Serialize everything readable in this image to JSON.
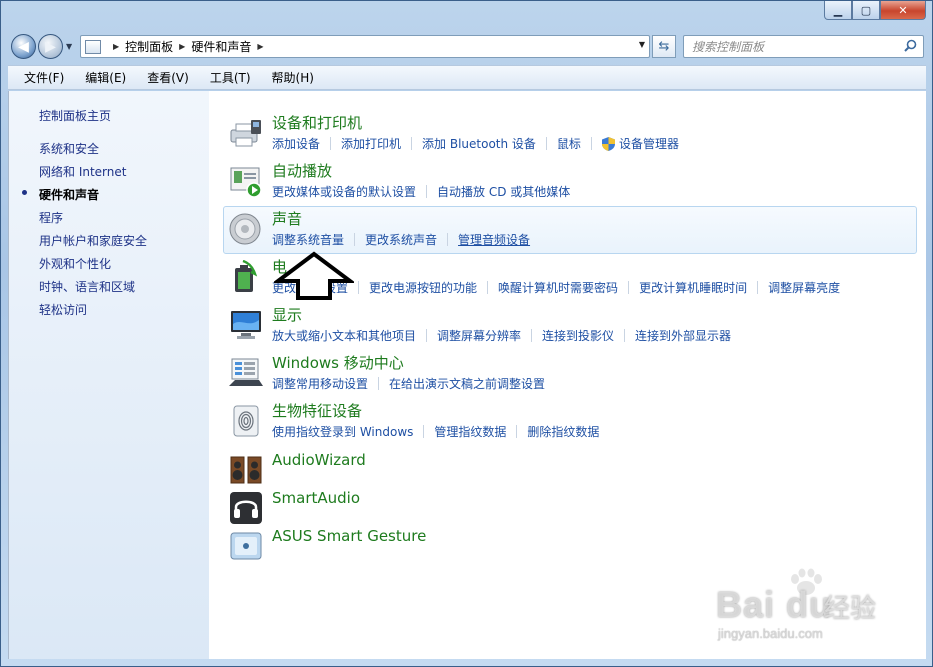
{
  "window": {
    "caption": {
      "minimize": "▁",
      "maximize": "▢",
      "close": "✕"
    }
  },
  "nav": {
    "breadcrumb": [
      "控制面板",
      "硬件和声音"
    ],
    "search_placeholder": "搜索控制面板"
  },
  "menu": [
    "文件(F)",
    "编辑(E)",
    "查看(V)",
    "工具(T)",
    "帮助(H)"
  ],
  "left_pane": {
    "home": "控制面板主页",
    "items": [
      "系统和安全",
      "网络和 Internet",
      "硬件和声音",
      "程序",
      "用户帐户和家庭安全",
      "外观和个性化",
      "时钟、语言和区域",
      "轻松访问"
    ],
    "current": "硬件和声音"
  },
  "categories": [
    {
      "title": "设备和打印机",
      "icon": "printer-icon",
      "links": [
        "添加设备",
        "添加打印机",
        "添加 Bluetooth 设备",
        "鼠标",
        "设备管理器"
      ]
    },
    {
      "title": "自动播放",
      "icon": "autoplay-icon",
      "links": [
        "更改媒体或设备的默认设置",
        "自动播放 CD 或其他媒体"
      ]
    },
    {
      "title": "声音",
      "icon": "speaker-icon",
      "links": [
        "调整系统音量",
        "更改系统声音",
        "管理音频设备"
      ]
    },
    {
      "title": "电源选项",
      "icon": "power-icon",
      "links": [
        "更改节能设置",
        "更改电源按钮的功能",
        "唤醒计算机时需要密码",
        "更改计算机睡眠时间",
        "调整屏幕亮度"
      ]
    },
    {
      "title": "显示",
      "icon": "display-icon",
      "links": [
        "放大或缩小文本和其他项目",
        "调整屏幕分辨率",
        "连接到投影仪",
        "连接到外部显示器"
      ]
    },
    {
      "title": "Windows 移动中心",
      "icon": "mobility-center-icon",
      "links": [
        "调整常用移动设置",
        "在给出演示文稿之前调整设置"
      ]
    },
    {
      "title": "生物特征设备",
      "icon": "fingerprint-icon",
      "links": [
        "使用指纹登录到 Windows",
        "管理指纹数据",
        "删除指纹数据"
      ]
    },
    {
      "title": "AudioWizard",
      "icon": "audiowizard-icon",
      "links": []
    },
    {
      "title": "SmartAudio",
      "icon": "headphones-icon",
      "links": []
    },
    {
      "title": "ASUS Smart Gesture",
      "icon": "touchpad-icon",
      "links": []
    }
  ],
  "partial_labels": {
    "power_title": "电",
    "power_first_link": "更改",
    "power_first_link_tail": "设置"
  },
  "watermark": {
    "brand": "Bai du",
    "cn": "经验",
    "url": "jingyan.baidu.com"
  },
  "colors": {
    "category_title": "#1e7b1e",
    "link": "#1e4fa3",
    "left_pane_link": "#1e3287"
  }
}
